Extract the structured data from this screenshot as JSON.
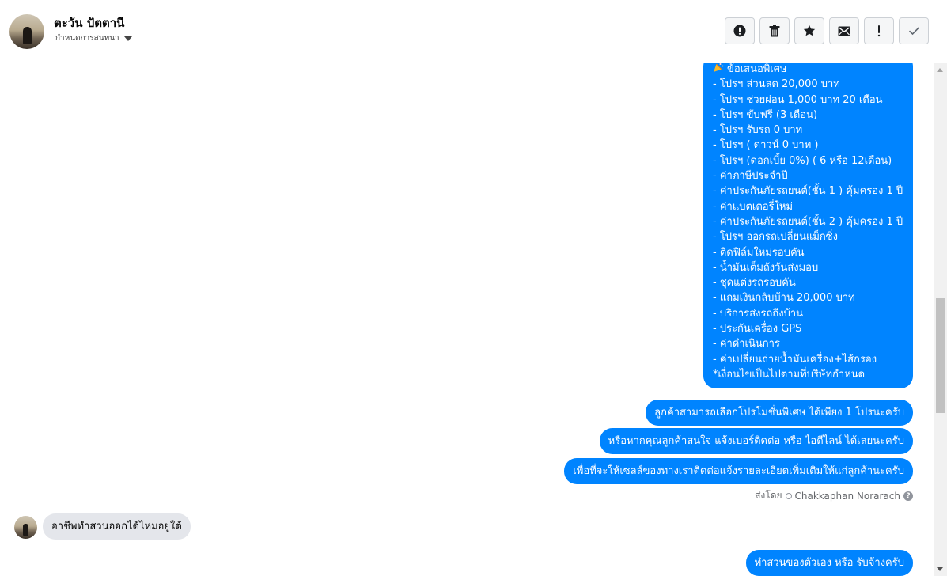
{
  "header": {
    "contact_name": "ตะวัน ปัตตานี",
    "status_label": "กำหนดการสนทนา",
    "toolbar": [
      {
        "name": "report-button",
        "icon": "exclamation-circle-icon"
      },
      {
        "name": "delete-button",
        "icon": "trash-icon"
      },
      {
        "name": "star-button",
        "icon": "star-icon"
      },
      {
        "name": "mark-unread-button",
        "icon": "envelope-icon"
      },
      {
        "name": "priority-button",
        "icon": "exclamation-icon"
      },
      {
        "name": "done-button",
        "icon": "checkmark-icon"
      }
    ]
  },
  "colors": {
    "outgoing_bubble": "#0084ff",
    "incoming_bubble": "#e4e6eb",
    "border": "#dadde1"
  },
  "messages": {
    "offer": {
      "title": "ข้อเสนอพิเศษ",
      "lines": [
        "- โปรฯ ส่วนลด 20,000 บาท",
        "- โปรฯ ช่วยผ่อน 1,000 บาท 20 เดือน",
        "- โปรฯ ขับฟรี (3 เดือน)",
        "- โปรฯ รับรถ 0 บาท",
        "- โปรฯ ( ดาวน์ 0 บาท )",
        "- โปรฯ (ดอกเบี้ย 0%) ( 6 หรือ 12เดือน)",
        "- ค่าภาษีประจำปี",
        "- ค่าประกันภัยรถยนต์(ชั้น 1 ) คุ้มครอง 1 ปี",
        "- ค่าแบตเตอรี่ใหม่",
        "- ค่าประกันภัยรถยนต์(ชั้น 2 ) คุ้มครอง 1 ปี",
        "- โปรฯ ออกรถเปลี่ยนแม็กซิ่ง",
        "- ติดฟิล์มใหม่รอบคัน",
        "- น้ำมันเต็มถังวันส่งมอบ",
        "- ชุดแต่งรถรอบคัน",
        "- แถมเงินกลับบ้าน 20,000 บาท",
        "- บริการส่งรถถึงบ้าน",
        "- ประกันเครื่อง GPS",
        "- ค่าดำเนินการ",
        "- ค่าเปลี่ยนถ่ายน้ำมันเครื่อง+ไส้กรอง"
      ],
      "footnote": "*เงื่อนไขเป็นไปตามที่บริษัทกำหนด"
    },
    "out_1": "ลูกค้าสามารถเลือกโปรโมชั่นพิเศษ ได้เพียง 1 โปรนะครับ",
    "out_2": "หรือหากคุณลูกค้าสนใจ แจ้งเบอร์ติดต่อ หรือ ไอดีไลน์ ได้เลยนะครับ",
    "out_3": "เพื่อที่จะให้เซลล์ของทางเราติดต่อแจ้งรายละเอียดเพิ่มเติมให้แก่ลูกค้านะครับ",
    "sent_by_label": "ส่งโดย",
    "sent_by_name": "Chakkaphan Norarach",
    "incoming_1": "อาชีพทำสวนออกได้ไหมอยู่ใต้",
    "out_4": "ทำสวนของตัวเอง หรือ รับจ้างครับ"
  }
}
